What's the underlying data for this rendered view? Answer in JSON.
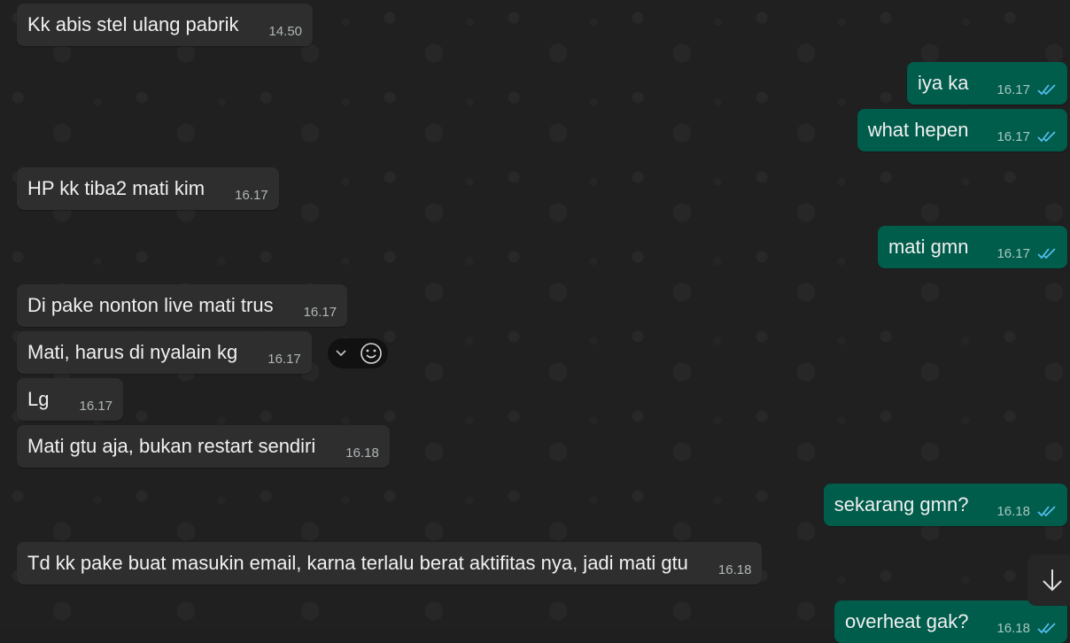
{
  "messages": [
    {
      "id": "m1",
      "dir": "in",
      "text": "Kk abis stel ulang pabrik",
      "time": "14.50"
    },
    {
      "id": "m2",
      "dir": "out",
      "text": "iya ka",
      "time": "16.17"
    },
    {
      "id": "m3",
      "dir": "out",
      "text": "what hepen",
      "time": "16.17"
    },
    {
      "id": "m4",
      "dir": "in",
      "text": "HP kk tiba2 mati kim",
      "time": "16.17"
    },
    {
      "id": "m5",
      "dir": "out",
      "text": "mati gmn",
      "time": "16.17"
    },
    {
      "id": "m6",
      "dir": "in",
      "text": "Di pake nonton live mati trus",
      "time": "16.17"
    },
    {
      "id": "m7",
      "dir": "in",
      "text": "Mati, harus di nyalain kg",
      "time": "16.17"
    },
    {
      "id": "m8",
      "dir": "in",
      "text": "Lg",
      "time": "16.17"
    },
    {
      "id": "m9",
      "dir": "in",
      "text": "Mati gtu aja, bukan restart sendiri",
      "time": "16.18"
    },
    {
      "id": "m10",
      "dir": "out",
      "text": "sekarang gmn?",
      "time": "16.18"
    },
    {
      "id": "m11",
      "dir": "in",
      "text": "Td kk pake buat masukin email, karna terlalu berat aktifitas nya, jadi mati gtu",
      "time": "16.18"
    },
    {
      "id": "m12",
      "dir": "out",
      "text": "overheat gak?",
      "time": "16.18"
    }
  ],
  "icons": {
    "read_receipt": "double-check-icon",
    "message_menu": "chevron-down-icon",
    "react": "smiley-icon",
    "scroll_down": "arrow-down-icon"
  },
  "colors": {
    "incoming_bubble": "#2e2e2e",
    "outgoing_bubble": "#005c4b",
    "read_tick": "#53bdeb"
  }
}
